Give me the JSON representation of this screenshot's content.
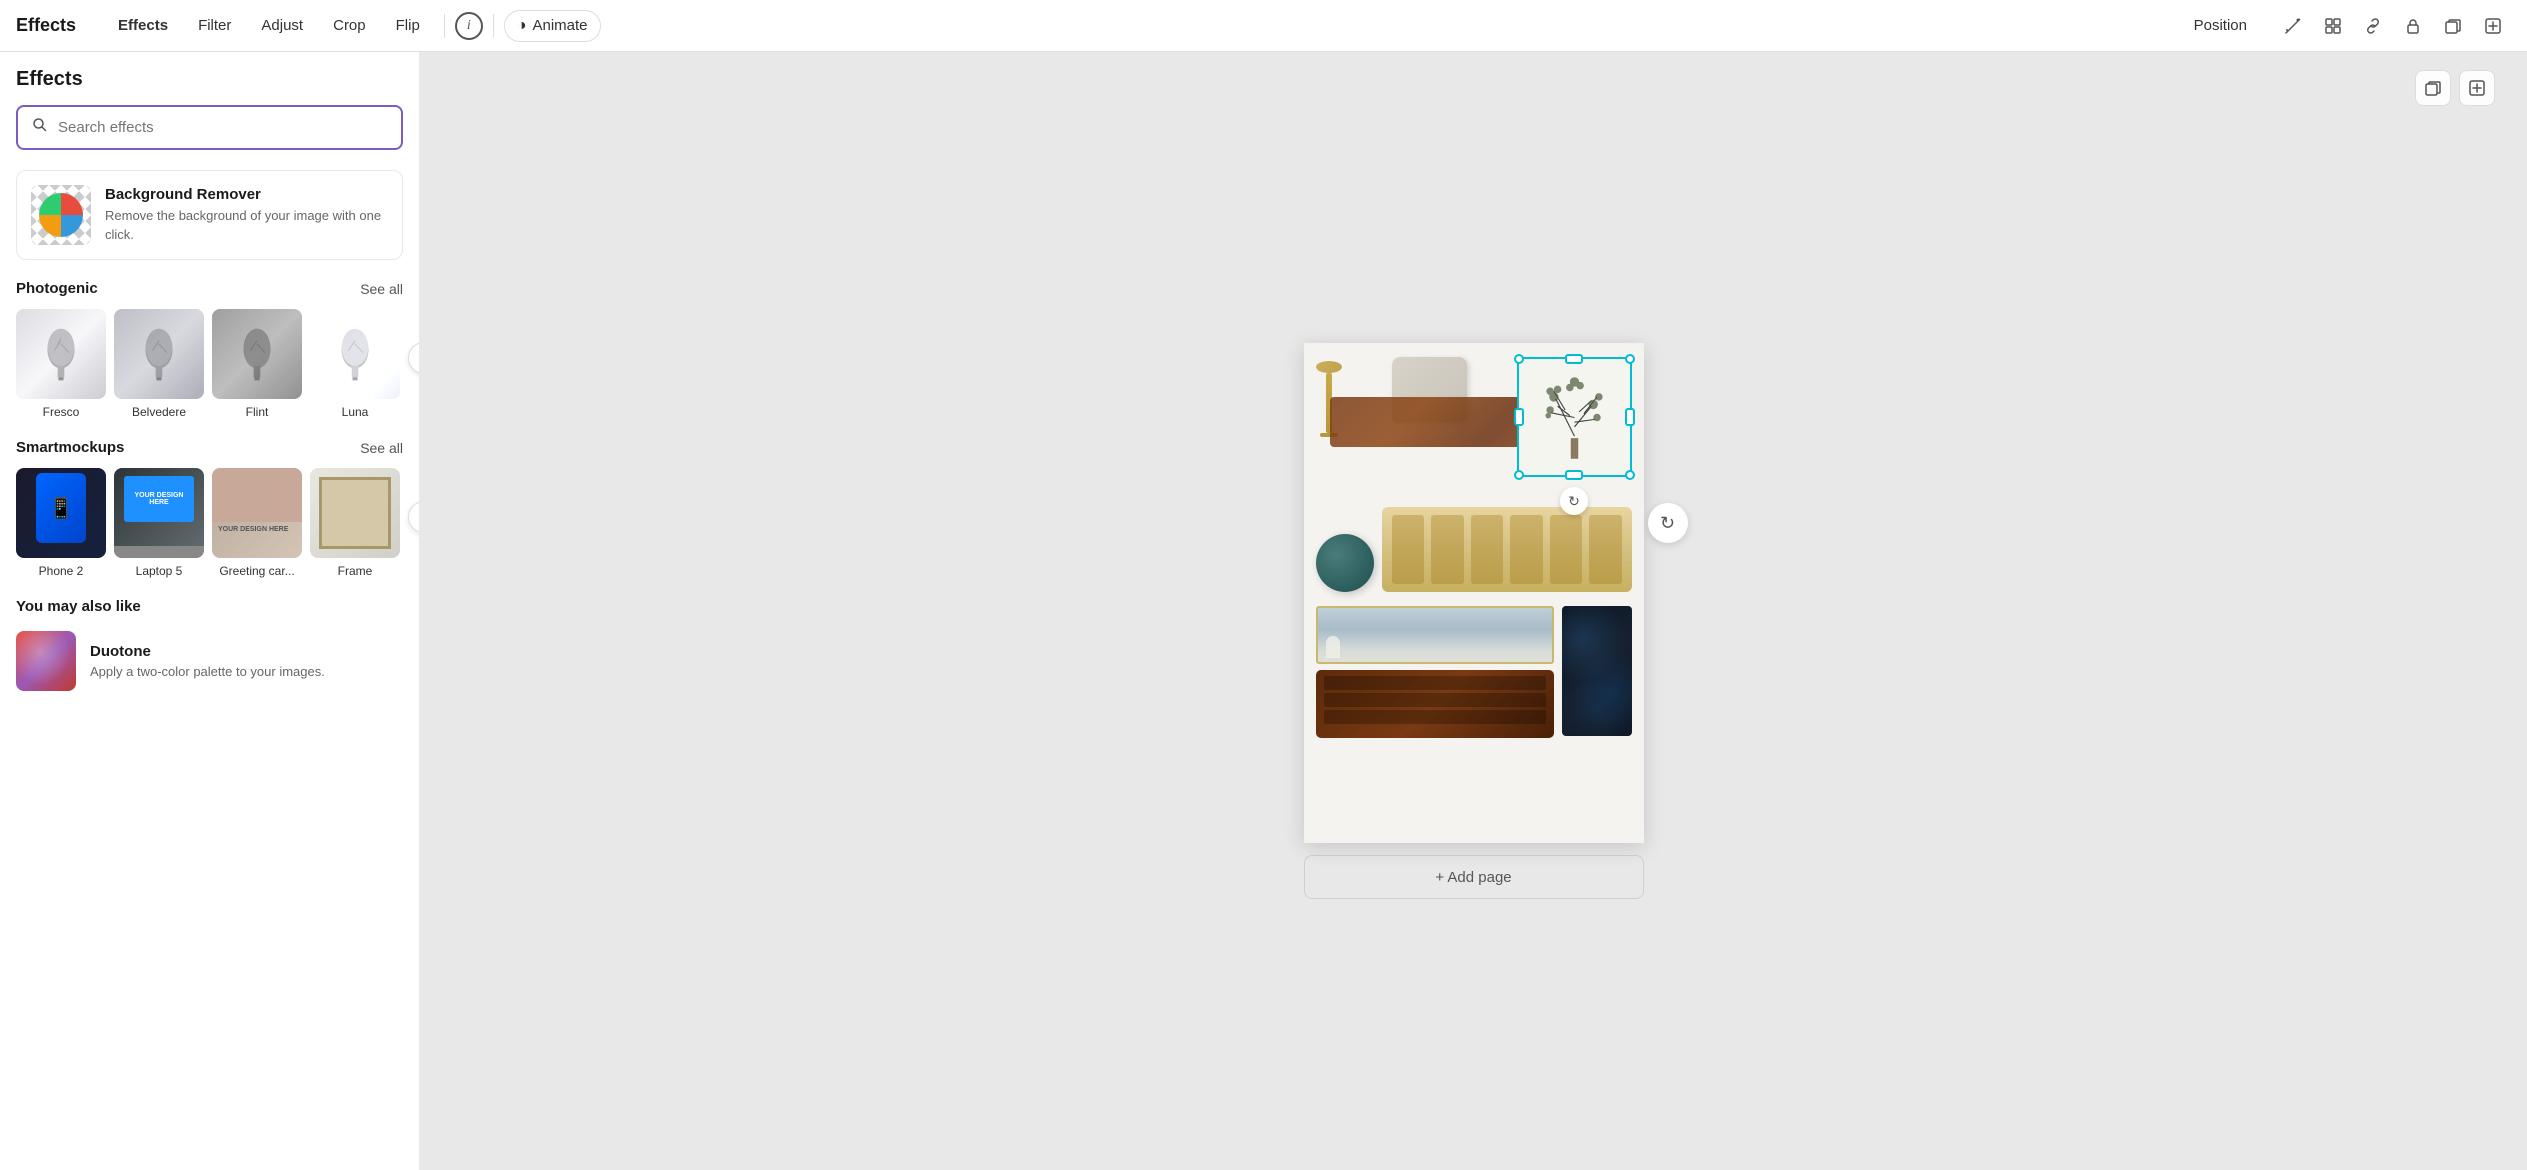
{
  "topbar": {
    "title": "Effects",
    "nav": [
      {
        "id": "effects",
        "label": "Effects",
        "active": true
      },
      {
        "id": "filter",
        "label": "Filter",
        "active": false
      },
      {
        "id": "adjust",
        "label": "Adjust",
        "active": false
      },
      {
        "id": "crop",
        "label": "Crop",
        "active": false
      },
      {
        "id": "flip",
        "label": "Flip",
        "active": false
      }
    ],
    "info_icon": "ⓘ",
    "animate_label": "Animate",
    "animate_icon": "◑",
    "position_label": "Position"
  },
  "left_panel": {
    "title": "Effects",
    "search_placeholder": "Search effects",
    "bg_remover": {
      "title": "Background Remover",
      "description": "Remove the background of your image with one click."
    },
    "photogenic": {
      "section_title": "Photogenic",
      "see_all": "See all",
      "items": [
        {
          "id": "fresco",
          "label": "Fresco"
        },
        {
          "id": "belvedere",
          "label": "Belvedere"
        },
        {
          "id": "flint",
          "label": "Flint"
        },
        {
          "id": "luna",
          "label": "Luna"
        }
      ],
      "next_arrow": "›"
    },
    "smartmockups": {
      "section_title": "Smartmockups",
      "see_all": "See all",
      "items": [
        {
          "id": "phone2",
          "label": "Phone 2"
        },
        {
          "id": "laptop5",
          "label": "Laptop 5"
        },
        {
          "id": "greeting",
          "label": "Greeting car..."
        },
        {
          "id": "frame",
          "label": "Frame"
        }
      ],
      "next_arrow": "›"
    },
    "you_may_like": {
      "section_title": "You may also like",
      "items": [
        {
          "id": "duotone",
          "title": "Duotone",
          "description": "Apply a two-color palette to your images."
        }
      ]
    }
  },
  "canvas": {
    "add_page_label": "+ Add page",
    "toolbar": {
      "copy_icon": "⧉",
      "add_icon": "+"
    }
  }
}
